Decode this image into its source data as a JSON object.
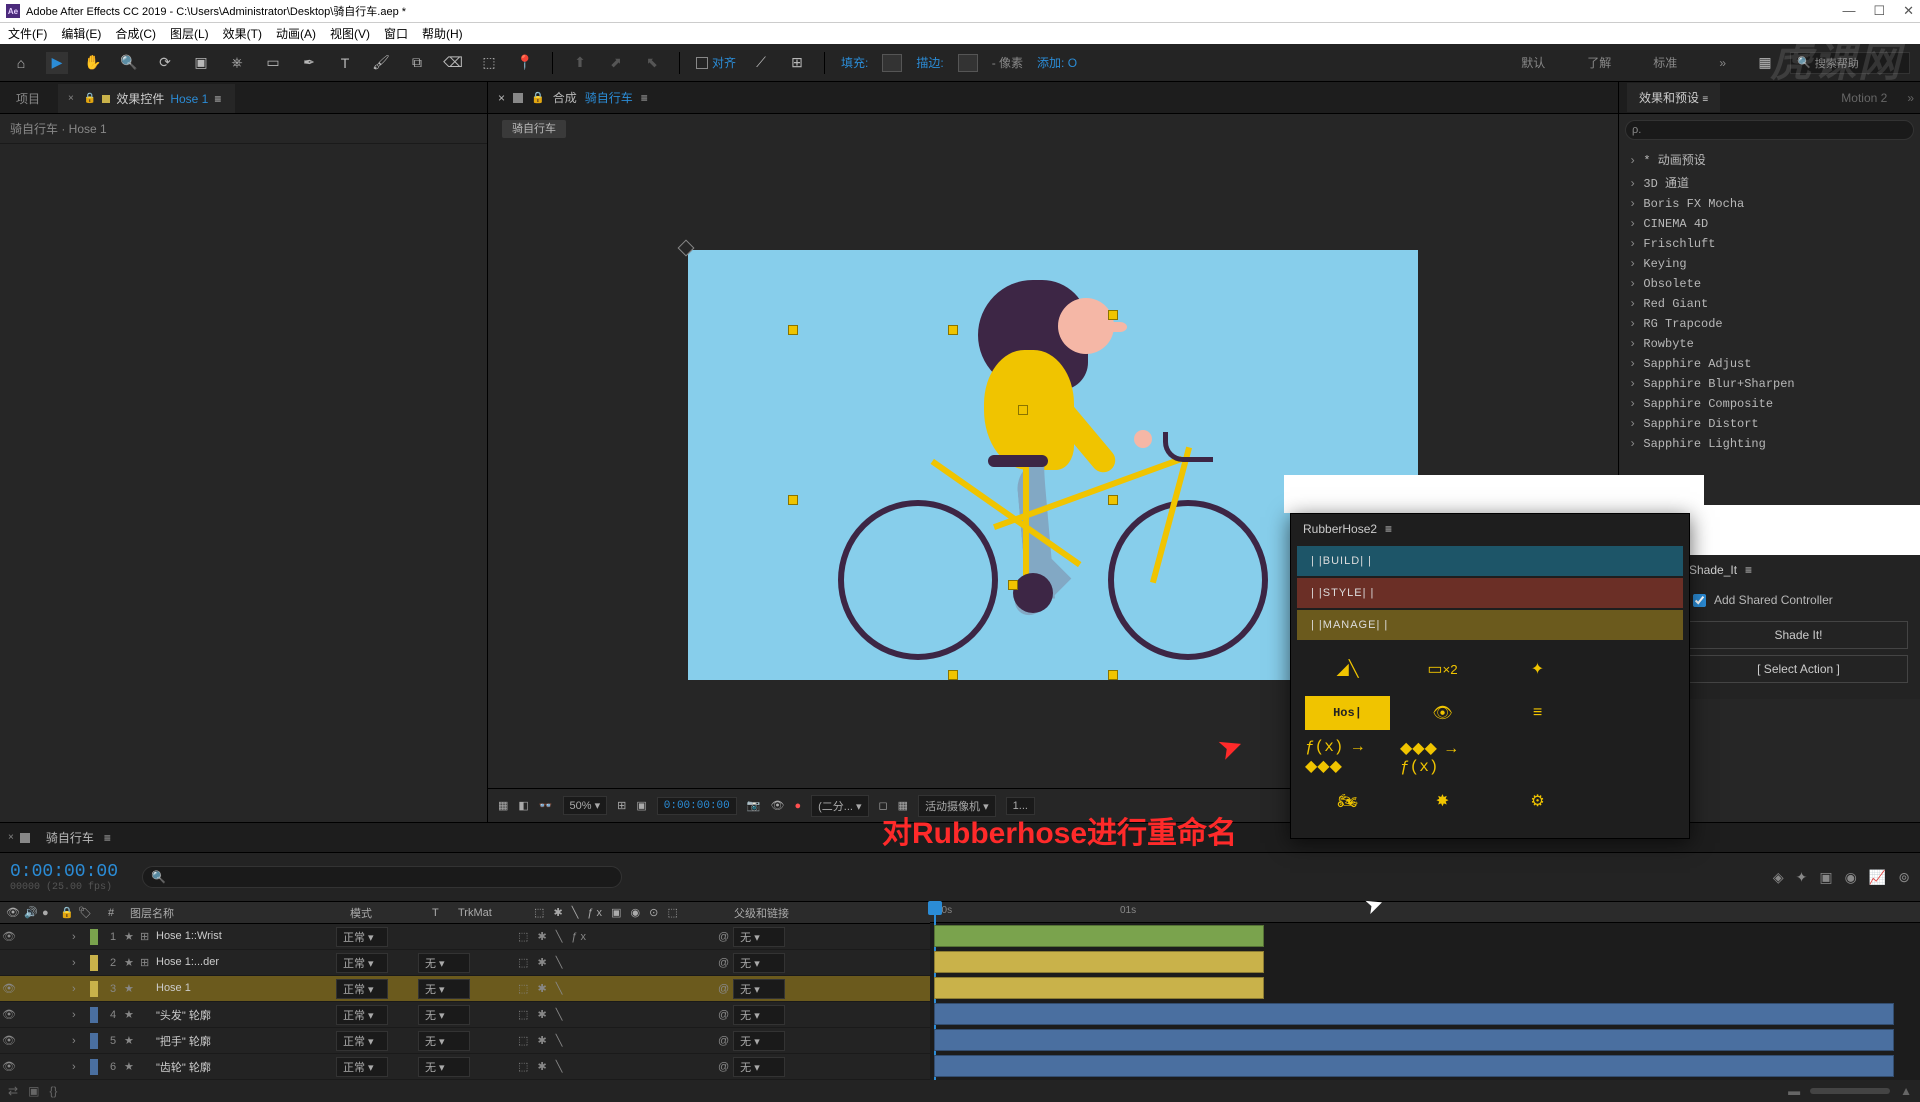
{
  "title": "Adobe After Effects CC 2019 - C:\\Users\\Administrator\\Desktop\\骑自行车.aep *",
  "menu": [
    "文件(F)",
    "编辑(E)",
    "合成(C)",
    "图层(L)",
    "效果(T)",
    "动画(A)",
    "视图(V)",
    "窗口",
    "帮助(H)"
  ],
  "toolbar": {
    "snap": "对齐",
    "fill": "填充:",
    "stroke": "描边:",
    "strokeVal": "- 像素",
    "add": "添加: O",
    "workspaces": [
      "默认",
      "了解",
      "标准"
    ],
    "searchPlaceholder": "搜索帮助"
  },
  "projectPanel": {
    "tabs": {
      "project": "项目",
      "fxControls": "效果控件",
      "fxTarget": "Hose 1"
    },
    "breadcrumb": "骑自行车 · Hose 1"
  },
  "compPanel": {
    "prefix": "合成",
    "name": "骑自行车",
    "crumb": "骑自行车"
  },
  "viewer": {
    "zoom": "50%",
    "timecode": "0:00:00:00",
    "res": "(二分...",
    "camera": "活动摄像机",
    "views": "1..."
  },
  "effectsPanel": {
    "tab1": "效果和预设",
    "tab2": "Motion 2",
    "search": "ρ.",
    "items": [
      "* 动画预设",
      "3D 通道",
      "Boris FX Mocha",
      "CINEMA 4D",
      "Frischluft",
      "Keying",
      "Obsolete",
      "Red Giant",
      "RG Trapcode",
      "Rowbyte",
      "Sapphire Adjust",
      "Sapphire Blur+Sharpen",
      "Sapphire Composite",
      "Sapphire Distort",
      "Sapphire Lighting"
    ]
  },
  "rubberhose": {
    "title": "RubberHose2",
    "build": "BUILD",
    "style": "STYLE",
    "manage": "MANAGE",
    "rename": "Hos|",
    "fx1": "ƒ(x) → ◆◆◆",
    "fx2": "◆◆◆ → ƒ(x)"
  },
  "annotation": "对Rubberhose进行重命名",
  "shadeit": {
    "title": "Shade_It",
    "check": "Add Shared Controller",
    "btn1": "Shade It!",
    "btn2": "[ Select Action ]"
  },
  "timeline": {
    "tab": "骑自行车",
    "time": "0:00:00:00",
    "fps": "00000 (25.00 fps)",
    "cols": {
      "layerName": "图层名称",
      "mode": "模式",
      "trk": "TrkMat",
      "T": "T",
      "parent": "父级和链接",
      "num": "#"
    },
    "ruler": [
      "00s",
      "01s"
    ],
    "layers": [
      {
        "n": 1,
        "c": "#7aa34d",
        "name": "Hose 1::Wrist",
        "mode": "正常",
        "trk": "",
        "parent": "无",
        "sel": false,
        "fx": true,
        "eye": true
      },
      {
        "n": 2,
        "c": "#c9b24a",
        "name": "Hose 1:...der",
        "mode": "正常",
        "trk": "无",
        "parent": "无",
        "sel": false,
        "fx": false,
        "eye": false
      },
      {
        "n": 3,
        "c": "#c9b24a",
        "name": "Hose 1",
        "mode": "正常",
        "trk": "无",
        "parent": "无",
        "sel": true,
        "fx": false,
        "eye": true
      },
      {
        "n": 4,
        "c": "#4a6fa0",
        "name": "\"头发\" 轮廓",
        "mode": "正常",
        "trk": "无",
        "parent": "无",
        "sel": false,
        "fx": false,
        "eye": true
      },
      {
        "n": 5,
        "c": "#4a6fa0",
        "name": "\"把手\" 轮廓",
        "mode": "正常",
        "trk": "无",
        "parent": "无",
        "sel": false,
        "fx": false,
        "eye": true
      },
      {
        "n": 6,
        "c": "#4a6fa0",
        "name": "\"齿轮\" 轮廓",
        "mode": "正常",
        "trk": "无",
        "parent": "无",
        "sel": false,
        "fx": false,
        "eye": true
      }
    ]
  },
  "watermark": "虎课网"
}
